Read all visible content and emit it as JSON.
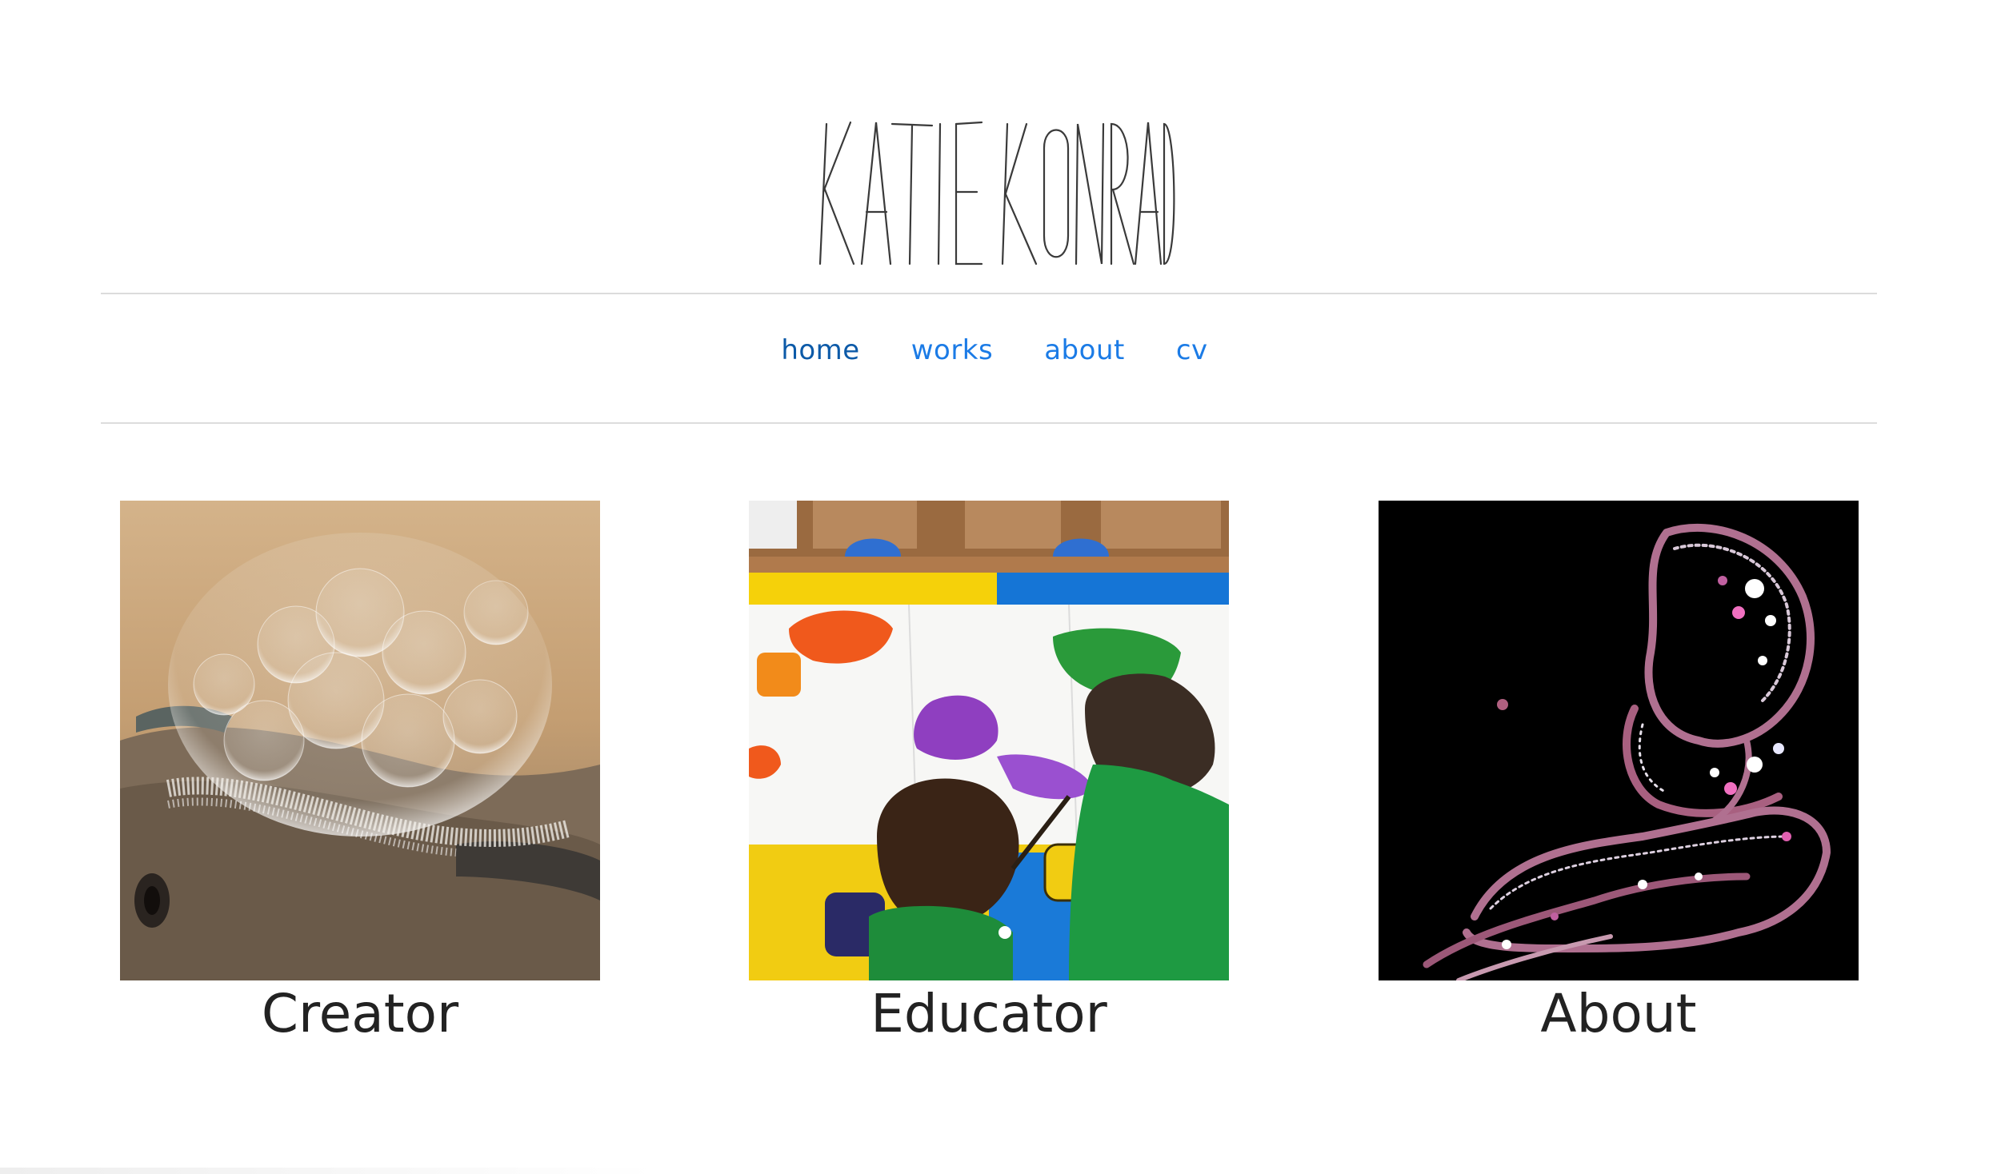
{
  "logo": {
    "text": "KATIE KONRAD",
    "stroke_color": "#3a3a3a"
  },
  "nav": {
    "items": [
      {
        "label": "home",
        "active": true
      },
      {
        "label": "works",
        "active": false
      },
      {
        "label": "about",
        "active": false
      },
      {
        "label": "cv",
        "active": false
      }
    ],
    "link_color": "#1b7be6",
    "active_color": "#0c5aa8"
  },
  "cards": [
    {
      "caption": "Creator",
      "image": "soap-bubbles-on-clay-sculpture"
    },
    {
      "caption": "Educator",
      "image": "children-painting-at-table"
    },
    {
      "caption": "About",
      "image": "abstract-figure-on-black"
    }
  ]
}
